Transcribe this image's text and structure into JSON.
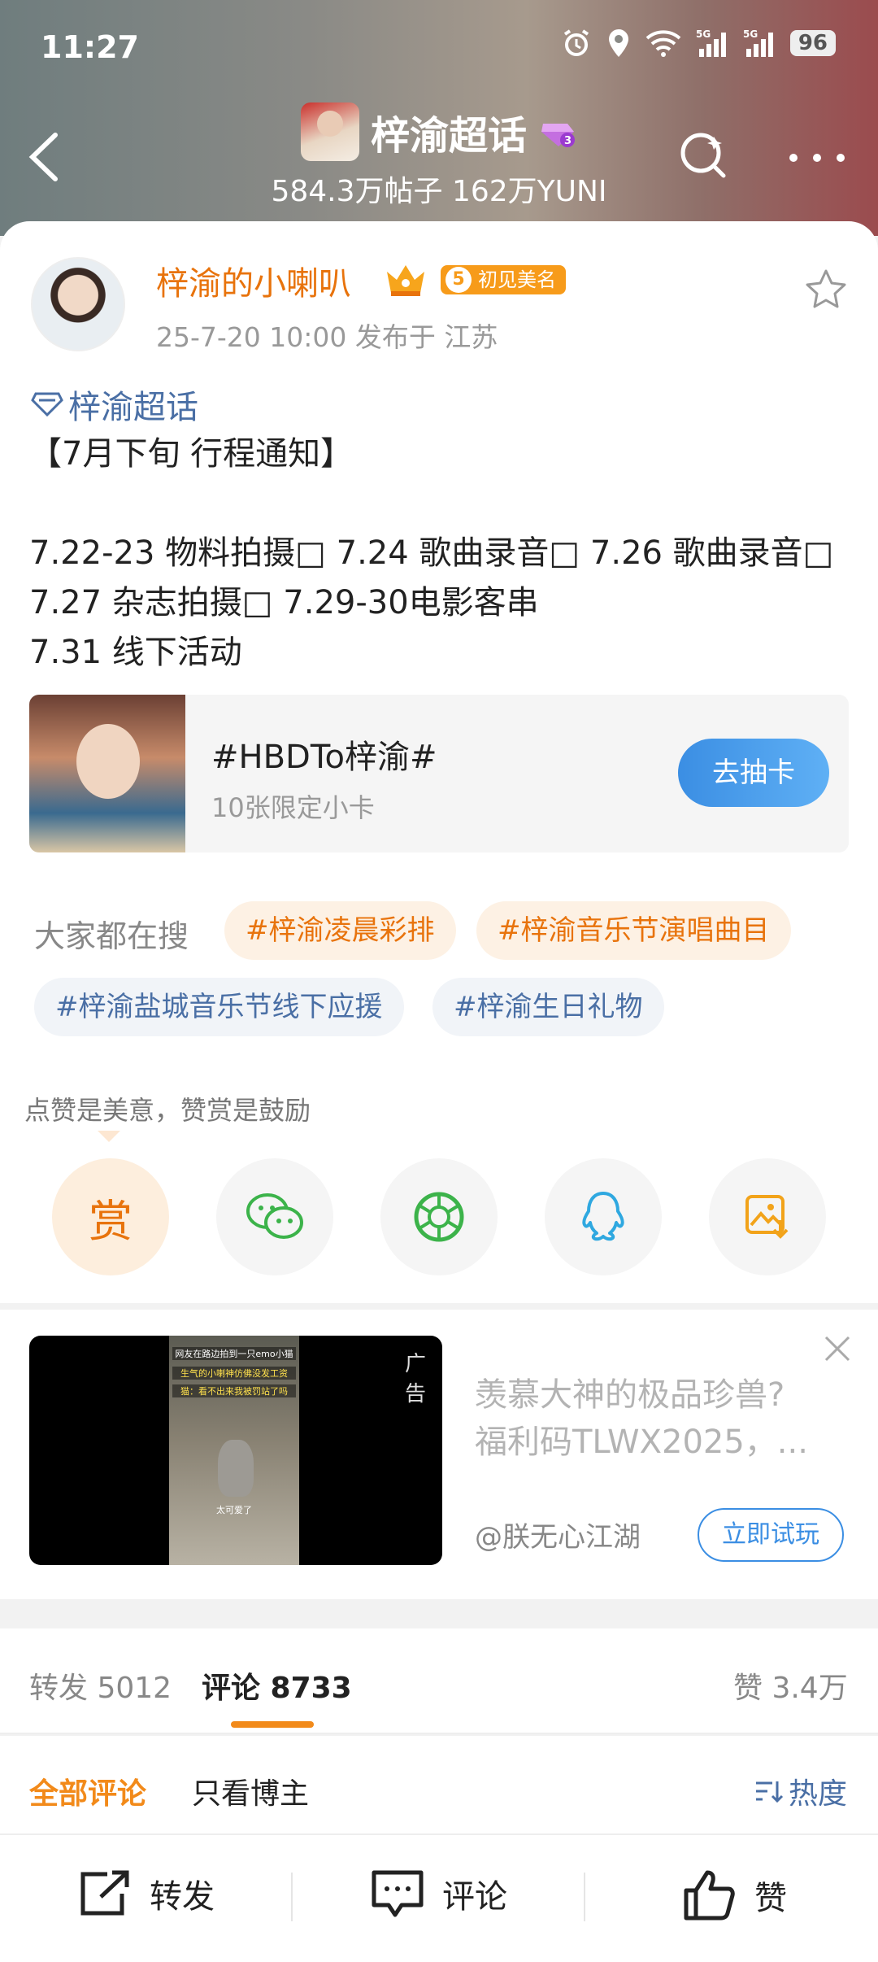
{
  "status_bar": {
    "time": "11:27",
    "battery": "96",
    "net1": "5G",
    "net2": "5G"
  },
  "header": {
    "title": "梓渝超话",
    "level": "3",
    "stats": "584.3万帖子 162万YUNI"
  },
  "post": {
    "author_name": "梓渝的小喇叭",
    "badge_level": "5",
    "badge_text": "初见美名",
    "meta": "25-7-20 10:00  发布于 江苏",
    "topic": "梓渝超话",
    "lines": [
      "【7月下旬 行程通知】",
      "",
      "7.22-23 物料拍摄\u0000 7.24 歌曲录音\u0000 7.26 歌曲录音\u0000",
      "7.27 杂志拍摄\u0000 7.29-30电影客串",
      "7.31 线下活动"
    ]
  },
  "card": {
    "title": "#HBDTo梓渝#",
    "subtitle": "10张限定小卡",
    "button": "去抽卡"
  },
  "search": {
    "label": "大家都在搜",
    "chips": [
      "#梓渝凌晨彩排",
      "#梓渝音乐节演唱曲目",
      "#梓渝盐城音乐节线下应援",
      "#梓渝生日礼物"
    ]
  },
  "reward": {
    "note": "点赞是美意，赞赏是鼓励",
    "reward_label": "赏"
  },
  "ad": {
    "label": "广告",
    "text_line1": "羡慕大神的极品珍兽?",
    "text_line2": "福利码TLWX2025，...",
    "source": "@朕无心江湖",
    "button": "立即试玩",
    "video_caption1": "网友在路边拍到一只emo小猫",
    "video_caption2": "生气的小喇神仿佛没发工资",
    "video_caption3": "猫：看不出来我被罚站了吗",
    "video_caption4": "太可爱了"
  },
  "stats": {
    "repost": "转发 5012",
    "comment": "评论 8733",
    "like": "赞 3.4万"
  },
  "filter": {
    "all": "全部评论",
    "owner": "只看博主",
    "sort": "热度"
  },
  "bottom": {
    "repost": "转发",
    "comment": "评论",
    "like": "赞"
  },
  "colors": {
    "accent_orange": "#e8730c",
    "link_blue": "#4a6fa5",
    "button_blue": "#3b8ee3"
  }
}
